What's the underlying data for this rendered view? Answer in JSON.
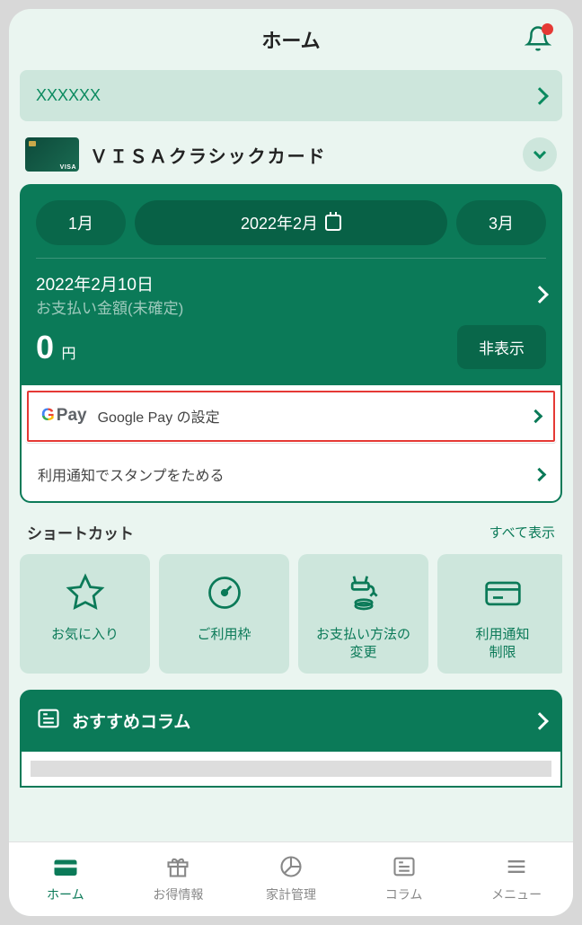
{
  "header": {
    "title": "ホーム"
  },
  "banner": {
    "text": "XXXXXX"
  },
  "card": {
    "name": "ＶＩＳＡクラシックカード"
  },
  "months": {
    "prev": "1月",
    "current": "2022年2月",
    "next": "3月"
  },
  "payment": {
    "date": "2022年2月10日",
    "label": "お支払い金額(未確定)",
    "amount": "0",
    "unit": "円",
    "hide_btn": "非表示"
  },
  "list": {
    "gpay_prefix": "G",
    "gpay_word": "Pay",
    "gpay_text": "Google Pay の設定",
    "stamp_text": "利用通知でスタンプをためる"
  },
  "shortcuts": {
    "title": "ショートカット",
    "all_link": "すべて表示",
    "items": [
      "お気に入り",
      "ご利用枠",
      "お支払い方法の\n変更",
      "利用通知\n制限"
    ]
  },
  "column": {
    "title": "おすすめコラム"
  },
  "nav": {
    "home": "ホーム",
    "deals": "お得情報",
    "finance": "家計管理",
    "column": "コラム",
    "menu": "メニュー"
  }
}
